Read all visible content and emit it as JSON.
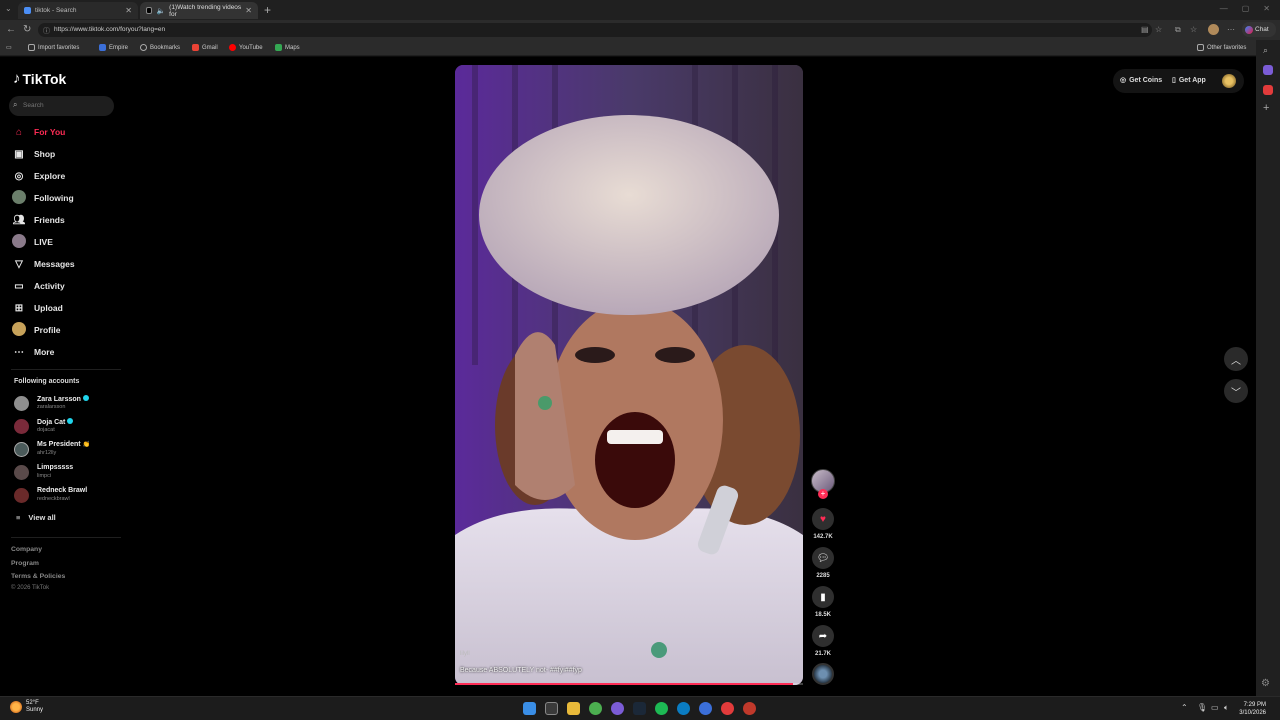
{
  "browser": {
    "tabs": [
      {
        "title": "tiktok - Search",
        "close": "✕"
      },
      {
        "title": "(1)Watch trending videos for",
        "close": "✕"
      }
    ],
    "new_tab": "+",
    "url": "https://www.tiktok.com/foryou?lang=en",
    "chat_label": "Chat",
    "favorites": [
      "Import favorites",
      "Empire",
      "Bookmarks",
      "Gmail",
      "YouTube",
      "Maps"
    ],
    "other_favorites": "Other favorites"
  },
  "tiktok": {
    "logo": "TikTok",
    "search_placeholder": "Search",
    "nav": [
      {
        "label": "For You",
        "icon": "home-icon"
      },
      {
        "label": "Shop",
        "icon": "shop-icon"
      },
      {
        "label": "Explore",
        "icon": "compass-icon"
      },
      {
        "label": "Following",
        "icon": "following-avatar-icon"
      },
      {
        "label": "Friends",
        "icon": "friends-icon"
      },
      {
        "label": "LIVE",
        "icon": "live-icon"
      },
      {
        "label": "Messages",
        "icon": "messages-icon"
      },
      {
        "label": "Activity",
        "icon": "activity-icon"
      },
      {
        "label": "Upload",
        "icon": "upload-icon"
      },
      {
        "label": "Profile",
        "icon": "profile-icon"
      },
      {
        "label": "More",
        "icon": "more-icon"
      }
    ],
    "following_title": "Following accounts",
    "following": [
      {
        "name": "Zara Larsson",
        "handle": "zaralarsson",
        "verified": true
      },
      {
        "name": "Doja Cat",
        "handle": "dojacat",
        "verified": true
      },
      {
        "name": "Ms President",
        "handle": "ahr12lly",
        "verified": false
      },
      {
        "name": "Limpsssss",
        "handle": "limpci",
        "verified": false
      },
      {
        "name": "Redneck Brawl",
        "handle": "redneckbrawl",
        "verified": false
      }
    ],
    "view_all": "View all",
    "footer": [
      "Company",
      "Program",
      "Terms & Policies"
    ],
    "copyright": "© 2026 TikTok",
    "top_right": {
      "coins": "Get Coins",
      "app": "Get App"
    },
    "video": {
      "user": "lilyll",
      "caption": "Because ABSOLUTELY not- ##fyi##fyp",
      "progress": 0.97,
      "likes": "142.7K",
      "comments": "2285",
      "saves": "18.5K",
      "shares": "21.7K"
    }
  },
  "taskbar": {
    "temp": "52°F",
    "condition": "Sunny",
    "time": "7:29 PM",
    "date": "3/10/2026"
  },
  "colors": {
    "accent": "#fe2c55",
    "verified": "#20d5ec"
  }
}
